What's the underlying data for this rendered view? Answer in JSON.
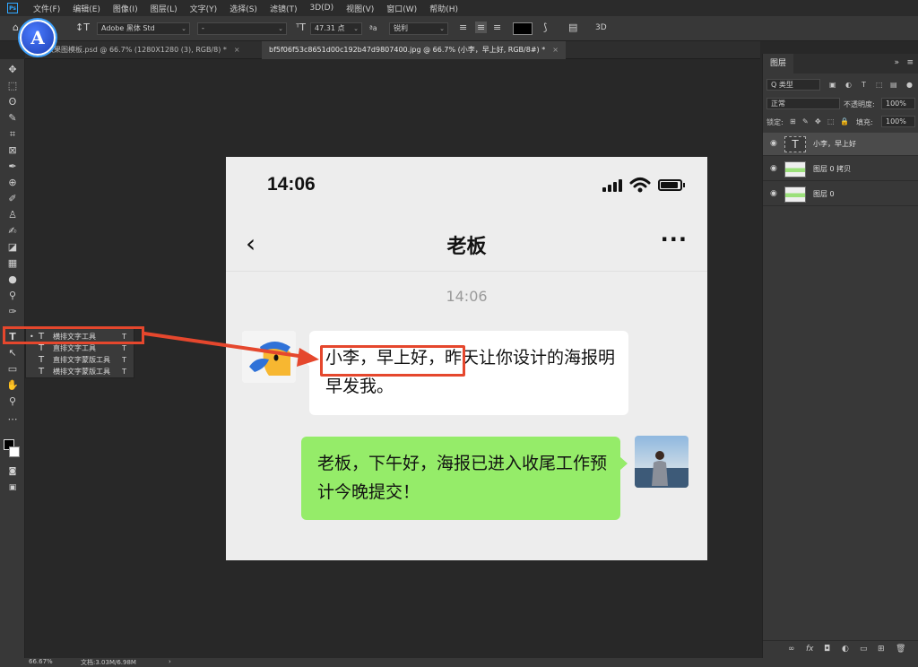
{
  "menu": [
    "文件(F)",
    "编辑(E)",
    "图像(I)",
    "图层(L)",
    "文字(Y)",
    "选择(S)",
    "滤镜(T)",
    "3D(D)",
    "视图(V)",
    "窗口(W)",
    "帮助(H)"
  ],
  "ps_logo": "Ps",
  "app_badge": "A",
  "options": {
    "font_family": "Adobe 黑体 Std",
    "font_style": "-",
    "font_size": "47.31 点",
    "aa_label": "ªa",
    "anti_alias": "锐利",
    "three_d": "3D"
  },
  "tabs": [
    {
      "label": "对比效果图模板.psd @ 66.7% (1280X1280 (3), RGB/8) *",
      "close": "×"
    },
    {
      "label": "bf5f06f53c8651d00c192b47d9807400.jpg @ 66.7% (小李，早上好, RGB/8#) *",
      "close": "×"
    }
  ],
  "phone": {
    "time": "14:06",
    "back": "‹",
    "title": "老板",
    "more": "···",
    "message_time": "14:06",
    "left_message": "小李，早上好，昨天让你设计的海报明早发我。",
    "right_message": "老板，下午好，海报已进入收尾工作预计今晚提交！"
  },
  "flyout": [
    {
      "icon": "T",
      "label": "横排文字工具",
      "key": "T",
      "bullet": "•"
    },
    {
      "icon": "T",
      "label": "直排文字工具",
      "key": "T",
      "bullet": ""
    },
    {
      "icon": "T",
      "label": "直排文字蒙版工具",
      "key": "T",
      "bullet": ""
    },
    {
      "icon": "T",
      "label": "横排文字蒙版工具",
      "key": "T",
      "bullet": ""
    }
  ],
  "layers_panel": {
    "tab": "图层",
    "collapse": "»",
    "filter": "Q 类型",
    "blend_mode": "正常",
    "opacity_label": "不透明度:",
    "opacity": "100%",
    "lock_label": "锁定:",
    "fill_label": "填充:",
    "fill": "100%",
    "layers": [
      {
        "name": "小李，早上好",
        "type": "text",
        "selected": true
      },
      {
        "name": "图层 0 拷贝",
        "type": "image",
        "selected": false
      },
      {
        "name": "图层 0",
        "type": "image",
        "selected": false
      }
    ]
  },
  "status": {
    "zoom": "66.67%",
    "doc": "文档:3.03M/6.98M",
    "arrow": "›"
  },
  "colors": {
    "accent_red": "#e5472d",
    "bubble_green": "#95ec69",
    "ps_blue": "#31a8ff"
  }
}
